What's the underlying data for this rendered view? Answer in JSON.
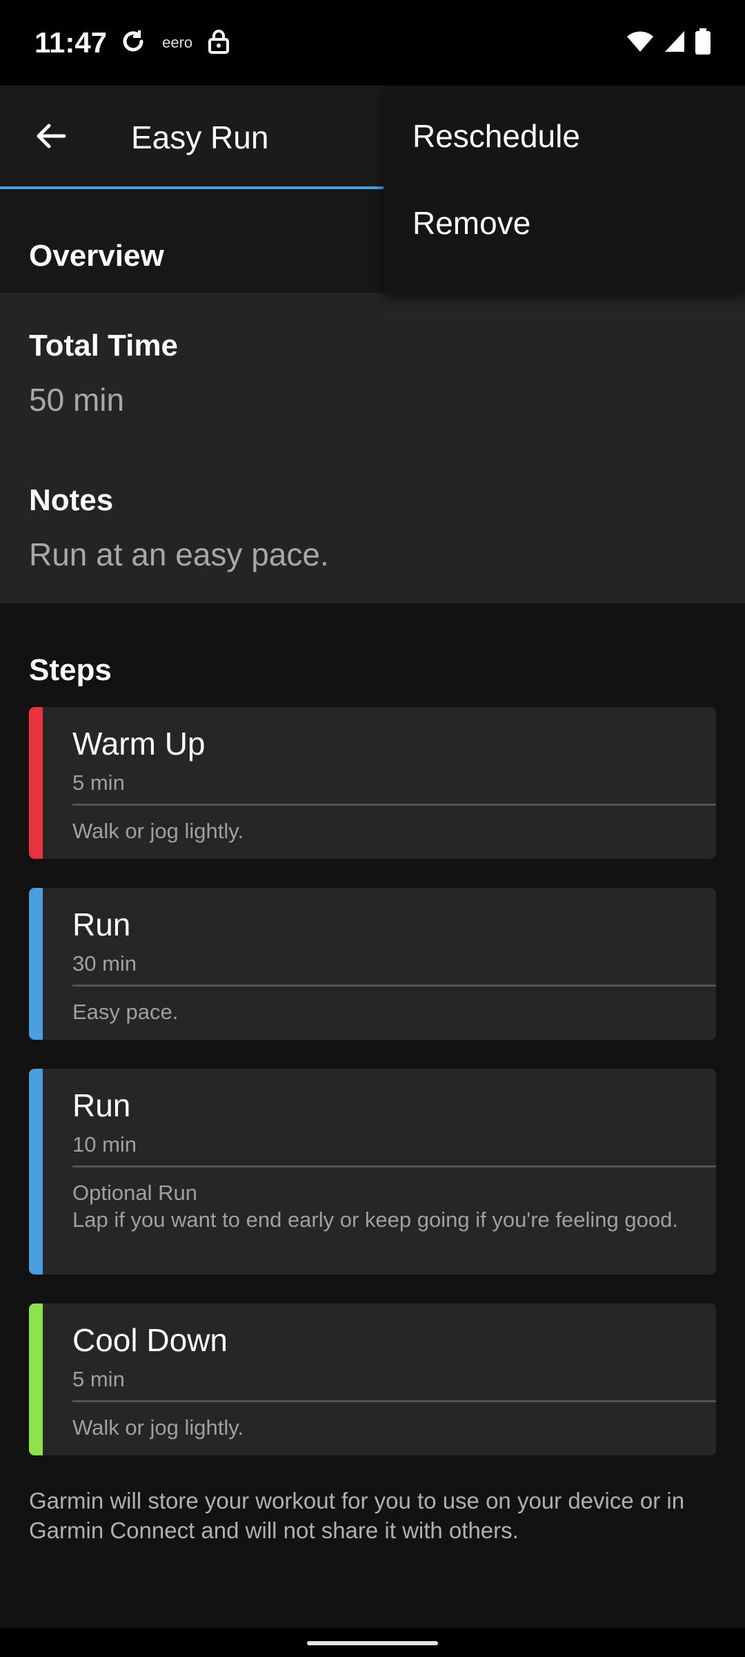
{
  "status_bar": {
    "time": "11:47",
    "network_label": "eero",
    "icons": [
      "sync-icon",
      "lock-icon",
      "wifi-icon",
      "signal-icon",
      "battery-icon"
    ]
  },
  "app_bar": {
    "title": "Easy Run",
    "accent_color": "#4a9fe0"
  },
  "menu": {
    "items": [
      {
        "label": "Reschedule"
      },
      {
        "label": "Remove"
      }
    ]
  },
  "overview": {
    "heading": "Overview",
    "total_time_label": "Total Time",
    "total_time_value": "50 min",
    "notes_label": "Notes",
    "notes_value": "Run at an easy pace."
  },
  "steps": {
    "heading": "Steps",
    "items": [
      {
        "title": "Warm Up",
        "duration": "5 min",
        "note": "Walk or jog lightly.",
        "color": "#e8333d"
      },
      {
        "title": "Run",
        "duration": "30 min",
        "note": "Easy pace.",
        "color": "#4a9fe0"
      },
      {
        "title": "Run",
        "duration": "10 min",
        "note_title": "Optional Run",
        "note": "Lap if you want to end early or keep going if you're feeling good.",
        "color": "#4a9fe0"
      },
      {
        "title": "Cool Down",
        "duration": "5 min",
        "note": "Walk or jog lightly.",
        "color": "#8ee34a"
      }
    ]
  },
  "disclaimer": "Garmin will store your workout for you to use on your device or in Garmin Connect and will not share it with others."
}
